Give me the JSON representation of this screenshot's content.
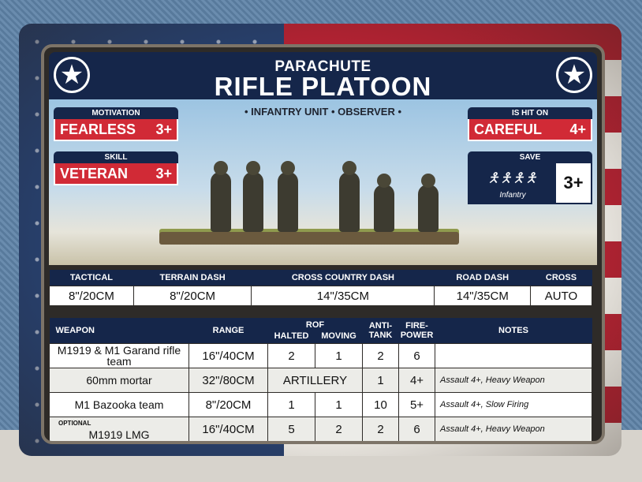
{
  "card": {
    "subtitle": "PARACHUTE",
    "title": "RIFLE PLATOON",
    "unit_type": "• INFANTRY UNIT • OBSERVER •",
    "motivation": {
      "label": "MOTIVATION",
      "value": "FEARLESS",
      "rating": "3+"
    },
    "skill": {
      "label": "SKILL",
      "value": "VETERAN",
      "rating": "3+"
    },
    "is_hit_on": {
      "label": "IS HIT ON",
      "value": "CAREFUL",
      "rating": "4+"
    },
    "save": {
      "label": "SAVE",
      "icon_label": "Infantry",
      "value": "3+"
    },
    "icons": {
      "star": "star-roundel-icon",
      "save": "infantry-silhouette-icon"
    },
    "colors": {
      "navy": "#15264a",
      "red": "#d12a36"
    }
  },
  "movement": {
    "headers": [
      "TACTICAL",
      "TERRAIN DASH",
      "CROSS COUNTRY DASH",
      "ROAD DASH",
      "CROSS"
    ],
    "values": [
      "8\"/20CM",
      "8\"/20CM",
      "14\"/35CM",
      "14\"/35CM",
      "AUTO"
    ]
  },
  "weapons": {
    "headers": {
      "weapon": "WEAPON",
      "range": "RANGE",
      "rof": "ROF",
      "halted": "HALTED",
      "moving": "MOVING",
      "anti_tank": "ANTI-TANK",
      "firepower": "FIRE-POWER",
      "notes": "NOTES"
    },
    "rows": [
      {
        "optional": "",
        "weapon": "M1919 & M1 Garand rifle team",
        "range": "16\"/40CM",
        "halted": "2",
        "moving": "1",
        "at": "2",
        "fp": "6",
        "notes": ""
      },
      {
        "optional": "",
        "weapon": "60mm mortar",
        "range": "32\"/80CM",
        "artillery": "ARTILLERY",
        "at": "1",
        "fp": "4+",
        "notes": "Assault 4+, Heavy Weapon"
      },
      {
        "optional": "",
        "weapon": "M1 Bazooka team",
        "range": "8\"/20CM",
        "halted": "1",
        "moving": "1",
        "at": "10",
        "fp": "5+",
        "notes": "Assault 4+, Slow Firing"
      },
      {
        "optional": "OPTIONAL",
        "weapon": "M1919 LMG",
        "range": "16\"/40CM",
        "halted": "5",
        "moving": "2",
        "at": "2",
        "fp": "6",
        "notes": "Assault 4+, Heavy Weapon"
      }
    ]
  }
}
